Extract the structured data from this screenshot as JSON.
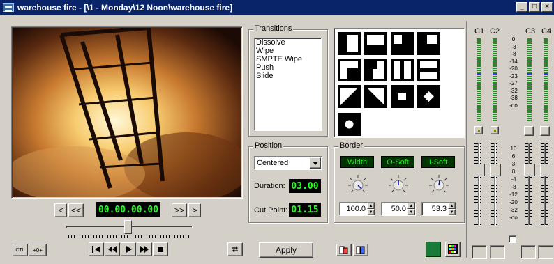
{
  "window": {
    "title": "warehouse fire - [\\1 - Monday\\12 Noon\\warehouse fire]",
    "min": "_",
    "max": "□",
    "close": "×"
  },
  "transport": {
    "prev": "<",
    "rewind_mark": "<<",
    "timecode": "00.00.00.00",
    "fwd_mark": ">>",
    "next": ">",
    "ctl": "CTL",
    "zero": "+0+"
  },
  "transitions": {
    "label": "Transitions",
    "items": [
      "Dissolve",
      "Wipe",
      "SMPTE Wipe",
      "Push",
      "Slide"
    ]
  },
  "wipes": {
    "patterns": [
      "left-bar",
      "bottom-bar",
      "br-corner",
      "tl-corner",
      "br-box",
      "tr-box",
      "v-split",
      "h-split",
      "diag-left",
      "diag-right",
      "center-box",
      "diamond",
      "circle"
    ]
  },
  "position": {
    "label": "Position",
    "selected": "Centered",
    "duration_label": "Duration:",
    "duration": "03.00",
    "cut_label": "Cut Point:",
    "cut": "01.15"
  },
  "border": {
    "label": "Border",
    "width_label": "Width",
    "osoft_label": "O-Soft",
    "isoft_label": "I-Soft",
    "width_val": "100.0",
    "osoft_val": "50.0",
    "isoft_val": "53.3"
  },
  "apply": {
    "label": "Apply"
  },
  "meters": {
    "channels": [
      "C1",
      "C2",
      "C3",
      "C4"
    ],
    "scale_top": [
      "0",
      "-3",
      "-8",
      "-14",
      "-20",
      "-23",
      "-27",
      "-32",
      "-38",
      "-oo"
    ],
    "scale_bottom": [
      "10",
      "6",
      "3",
      "0",
      "-4",
      "-8",
      "-12",
      "-20",
      "-32",
      "-oo"
    ]
  },
  "colors": {
    "title_bar": "#0a246a",
    "lcd_text": "#22ff22",
    "status_green": "#1a7a3a"
  }
}
